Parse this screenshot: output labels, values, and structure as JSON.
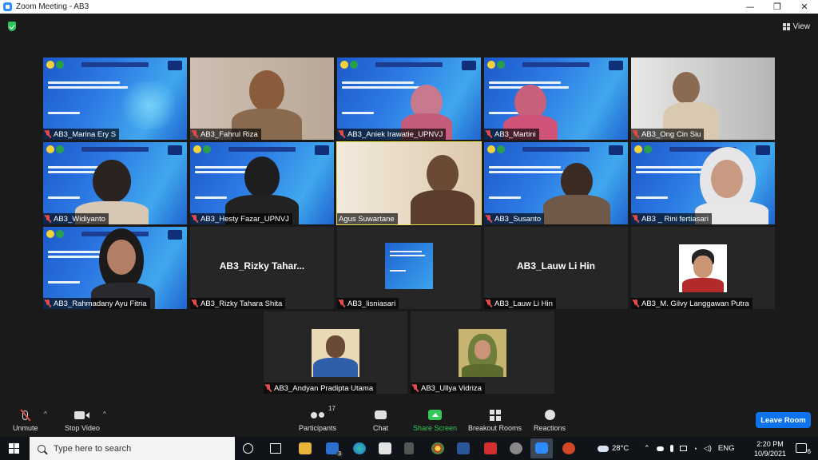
{
  "window": {
    "title": "Zoom Meeting - AB3",
    "min": "—",
    "max": "❐",
    "close": "✕"
  },
  "view_label": "View",
  "participants": [
    {
      "name": "AB3_Marina Ery S"
    },
    {
      "name": "AB3_Fahrul Riza"
    },
    {
      "name": "AB3_Aniek Irawatie_UPNVJ"
    },
    {
      "name": "AB3_Martini"
    },
    {
      "name": "AB3_Ong Cin Siu"
    },
    {
      "name": "AB3_Widiyanto"
    },
    {
      "name": "AB3_Hesty Fazar_UPNVJ"
    },
    {
      "name": "Agus Suwartane"
    },
    {
      "name": "AB3_Susanto"
    },
    {
      "name": "AB3 _ Rini fertiasari"
    },
    {
      "name": "AB3_Rahmadany Ayu Fitria"
    },
    {
      "name": "AB3_Rizky Tahara Shita",
      "display": "AB3_Rizky  Tahar..."
    },
    {
      "name": "AB3_lisniasari"
    },
    {
      "name": "AB3_Lauw Li Hin",
      "display": "AB3_Lauw Li Hin"
    },
    {
      "name": "AB3_M. Gilvy Langgawan Putra"
    },
    {
      "name": "AB3_Andyan Pradipta Utama"
    },
    {
      "name": "AB3_Ullya Vidriza"
    }
  ],
  "toolbar": {
    "unmute": "Unmute",
    "stop_video": "Stop Video",
    "participants": "Participants",
    "participants_count": "17",
    "chat": "Chat",
    "share_screen": "Share Screen",
    "breakout_rooms": "Breakout Rooms",
    "reactions": "Reactions",
    "leave": "Leave Room"
  },
  "taskbar": {
    "search_placeholder": "Type here to search",
    "mail_badge": "3",
    "temperature": "28°C",
    "language": "ENG",
    "time": "2:20 PM",
    "date": "10/9/2021",
    "notifications": "6"
  }
}
